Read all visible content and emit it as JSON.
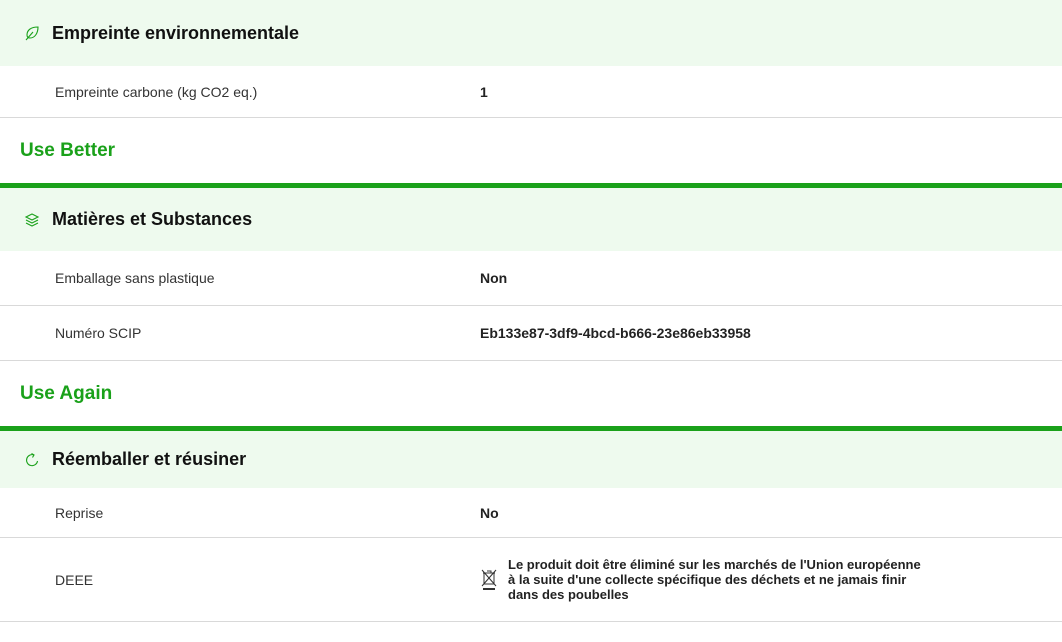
{
  "env": {
    "title": "Empreinte environnementale",
    "icon": "leaf-icon",
    "rows": [
      {
        "label": "Empreinte carbone (kg CO2 eq.)",
        "value": "1"
      }
    ]
  },
  "use_better": {
    "title": "Use Better",
    "section": {
      "title": "Matières et Substances",
      "icon": "layers-icon",
      "rows": [
        {
          "label": "Emballage sans plastique",
          "value": "Non"
        },
        {
          "label": "Numéro SCIP",
          "value": "Eb133e87-3df9-4bcd-b666-23e86eb33958"
        }
      ]
    }
  },
  "use_again": {
    "title": "Use Again",
    "section": {
      "title": "Réemballer et réusiner",
      "icon": "refresh-icon",
      "rows": [
        {
          "label": "Reprise",
          "value": "No"
        },
        {
          "label": "DEEE",
          "value": "Le produit doit être éliminé sur les marchés de l'Union européenne à la suite d'une collecte spécifique des déchets et ne jamais finir dans des poubelles",
          "icon": "crossed-bin-icon"
        }
      ]
    }
  },
  "colors": {
    "accent": "#1aa11a",
    "header_bg": "#eefaee"
  }
}
